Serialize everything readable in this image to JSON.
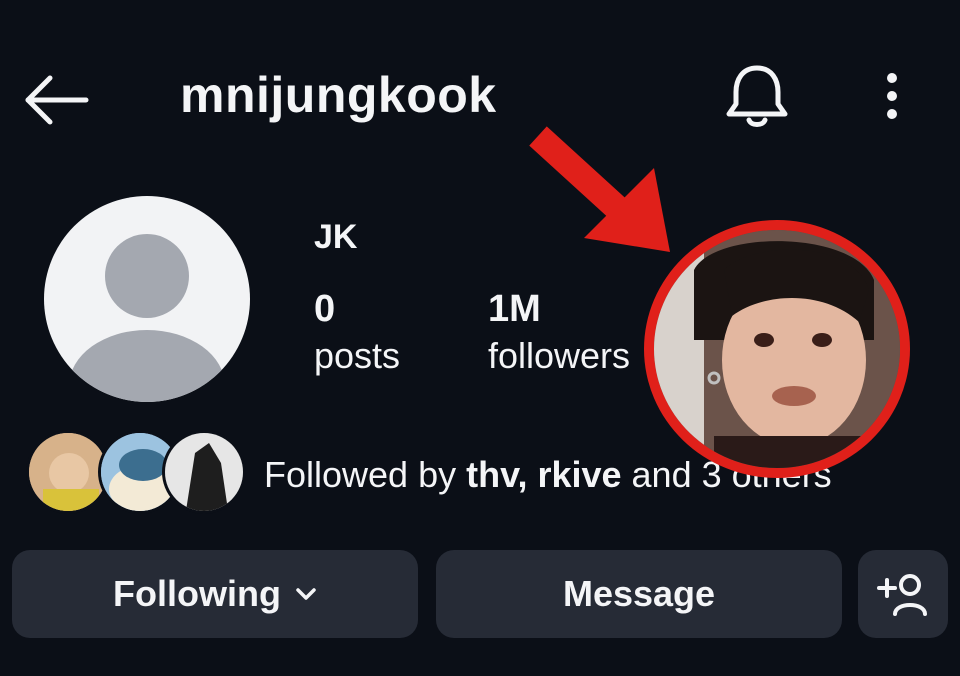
{
  "header": {
    "username": "mnijungkook",
    "back_icon": "arrow-left-icon",
    "notification_icon": "bell-icon",
    "more_icon": "more-vertical-icon"
  },
  "profile": {
    "display_name": "JK",
    "posts_count": "0",
    "posts_label": "posts",
    "followers_count": "1M",
    "followers_label": "followers"
  },
  "followed_by": {
    "prefix": "Followed by ",
    "names": "thv, rkive",
    "suffix": " and 3 others"
  },
  "actions": {
    "following_label": "Following",
    "message_label": "Message",
    "add_person_icon": "add-person-icon"
  },
  "annotation": {
    "color": "#e0201a"
  }
}
